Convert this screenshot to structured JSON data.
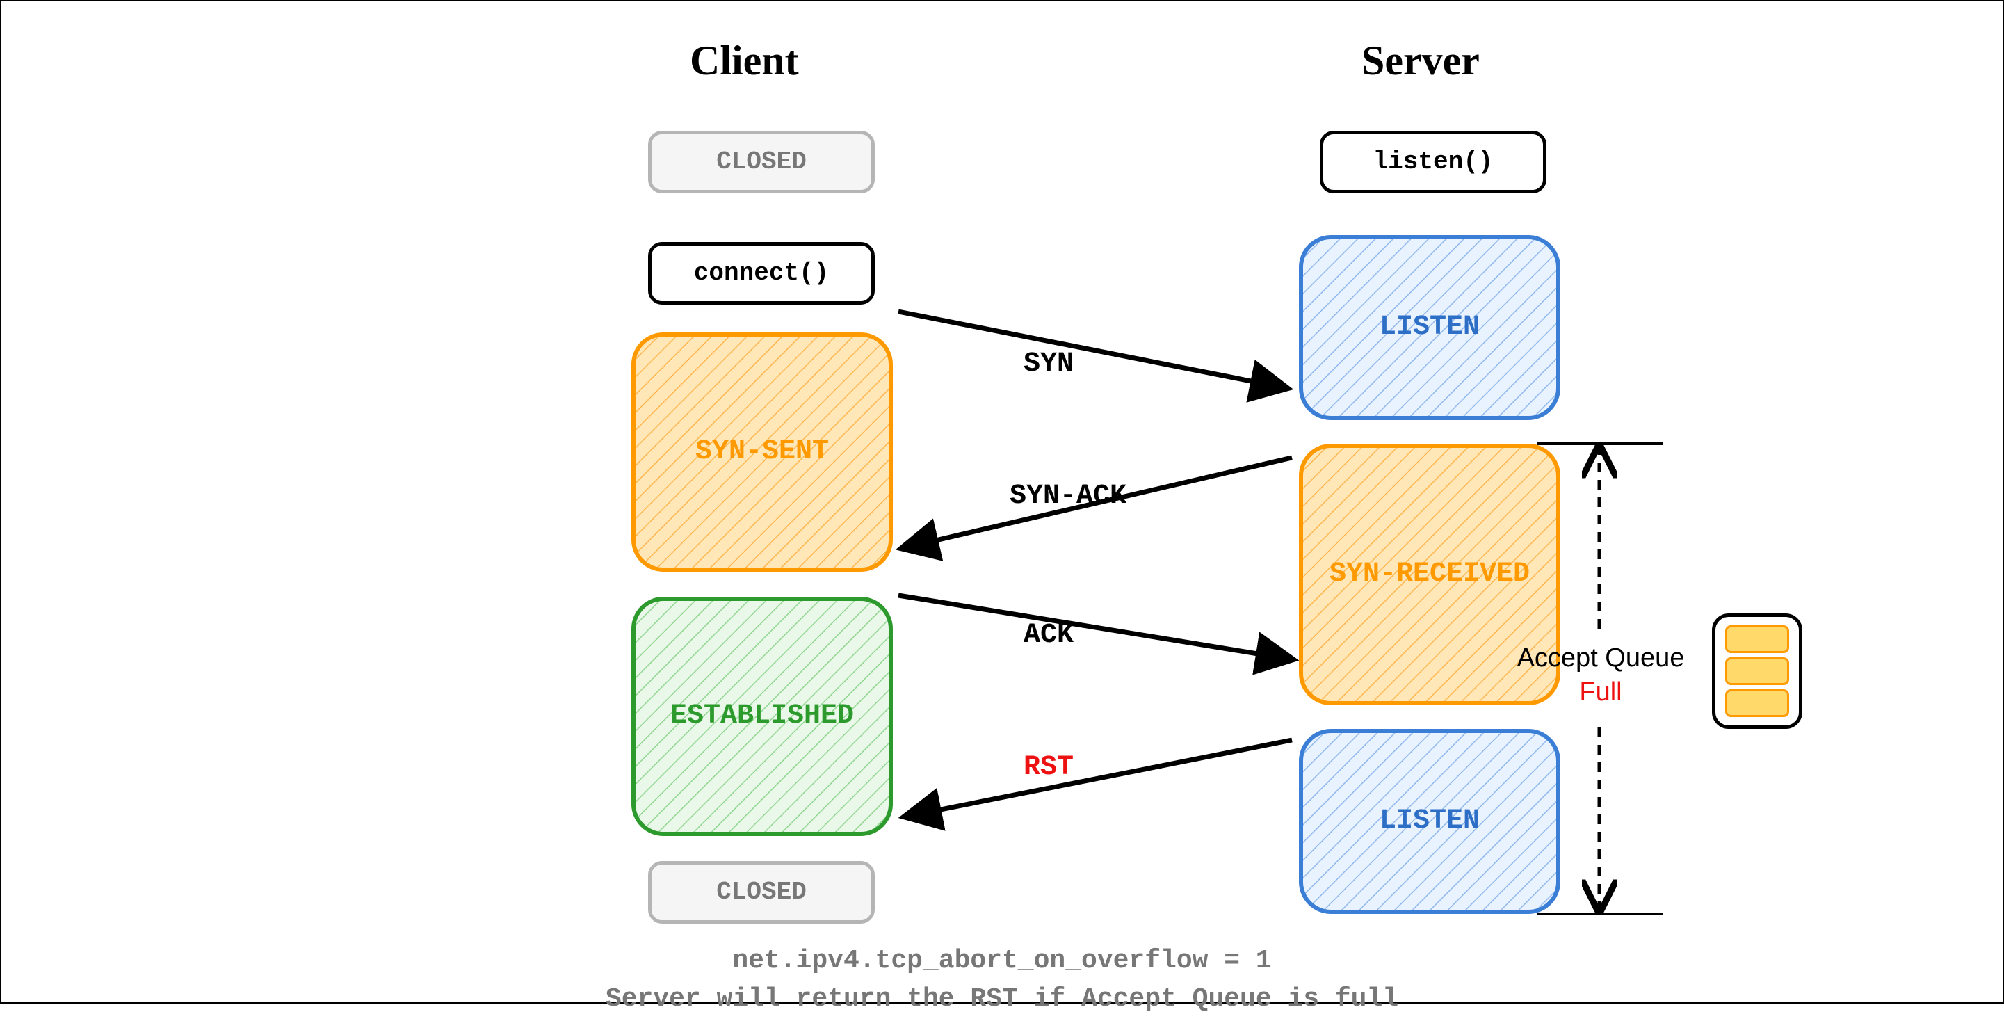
{
  "headers": {
    "client": "Client",
    "server": "Server"
  },
  "client": {
    "closed_top": "CLOSED",
    "connect": "connect()",
    "syn_sent": "SYN-SENT",
    "established": "ESTABLISHED",
    "closed_bottom": "CLOSED"
  },
  "server": {
    "listen_call": "listen()",
    "listen_top": "LISTEN",
    "syn_received": "SYN-RECEIVED",
    "listen_bottom": "LISTEN"
  },
  "messages": {
    "syn": "SYN",
    "synack": "SYN-ACK",
    "ack": "ACK",
    "rst": "RST"
  },
  "accept_queue": {
    "label": "Accept Queue",
    "status": "Full"
  },
  "caption": {
    "line1": "net.ipv4.tcp_abort_on_overflow = 1",
    "line2": "Server will return the RST if Accept Queue is full"
  },
  "colors": {
    "orange": "#ff9900",
    "orange_fill": "#ffe7b8",
    "blue": "#3a7fd5",
    "blue_fill": "#dbeafe",
    "green": "#2c9a2c",
    "green_fill": "#e3f7e3",
    "grey": "#b5b5b5",
    "grey_fill": "#f5f5f5"
  }
}
